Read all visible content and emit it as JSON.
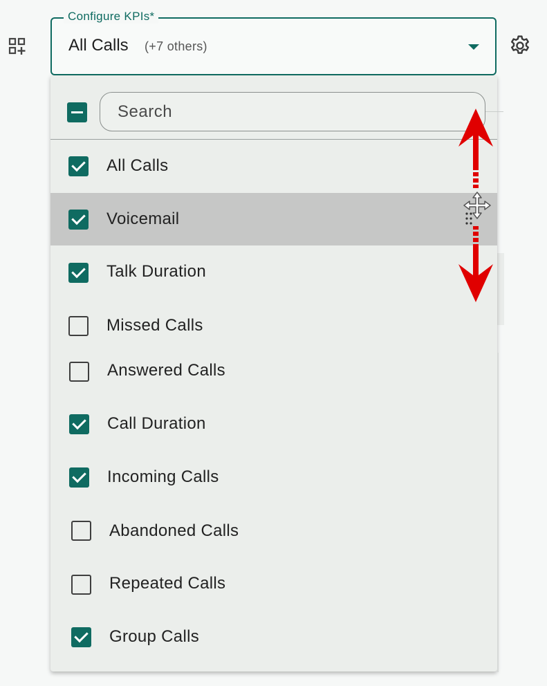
{
  "toolbar": {
    "add_widget_icon": "dashboard-add-icon",
    "settings_icon": "gear-icon"
  },
  "kpi_select": {
    "label": "Configure KPIs*",
    "value": "All Calls",
    "others": "(+7 others)",
    "accent_color": "#0f6b61"
  },
  "dropdown": {
    "select_all_state": "indeterminate",
    "search_placeholder": "Search",
    "highlight_color": "#c6c7c6",
    "items": [
      {
        "label": "All Calls",
        "checked": true
      },
      {
        "label": "Voicemail",
        "checked": true,
        "highlighted": true
      },
      {
        "label": "Talk Duration",
        "checked": true
      },
      {
        "label": "Missed Calls",
        "checked": false
      },
      {
        "label": "Answered Calls",
        "checked": false
      },
      {
        "label": "Call Duration",
        "checked": true
      },
      {
        "label": "Incoming Calls",
        "checked": true
      },
      {
        "label": "Abandoned Calls",
        "checked": false
      },
      {
        "label": "Repeated Calls",
        "checked": false
      },
      {
        "label": "Group Calls",
        "checked": true
      }
    ]
  },
  "annotation": {
    "cursor_icon": "move-cursor-icon",
    "drag_handle_icon": "drag-handle-icon",
    "arrow_color": "#e00000",
    "arrow_icons": [
      "arrow-up-icon",
      "arrow-down-icon"
    ]
  }
}
